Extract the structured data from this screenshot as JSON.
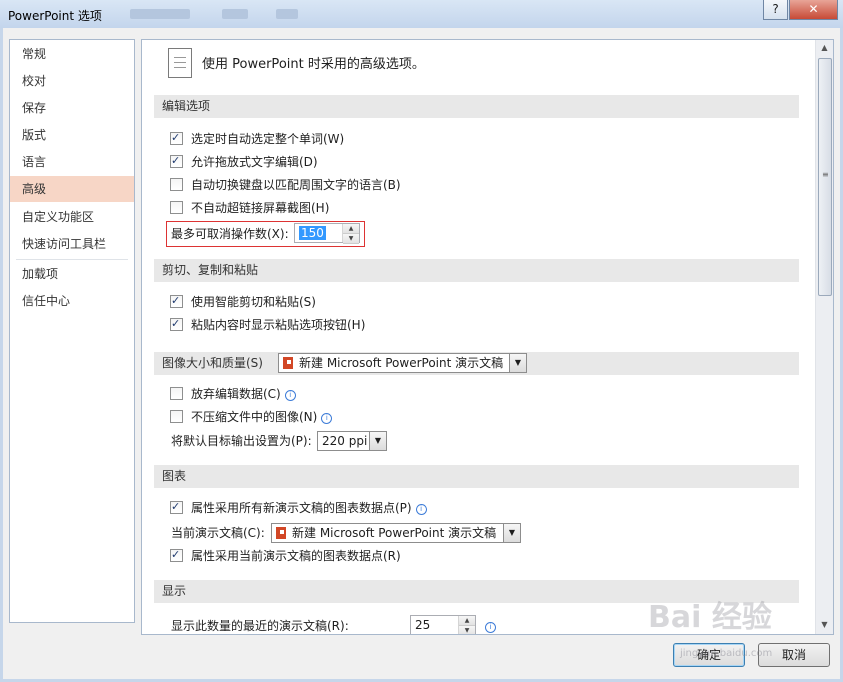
{
  "window": {
    "title": "PowerPoint 选项",
    "help_label": "?",
    "close_label": "✕"
  },
  "nav": {
    "items": [
      "常规",
      "校对",
      "保存",
      "版式",
      "语言",
      "高级",
      "自定义功能区",
      "快速访问工具栏",
      "加载项",
      "信任中心"
    ],
    "selected": "高级"
  },
  "header": {
    "text": "使用 PowerPoint 时采用的高级选项。"
  },
  "sections": {
    "edit": "编辑选项",
    "clipboard": "剪切、复制和粘贴",
    "image": "图像大小和质量(S)",
    "chart": "图表",
    "display": "显示"
  },
  "edit_options": {
    "opt1": "选定时自动选定整个单词(W)",
    "opt2": "允许拖放式文字编辑(D)",
    "opt3": "自动切换键盘以匹配周围文字的语言(B)",
    "opt4": "不自动超链接屏幕截图(H)",
    "undo_label": "最多可取消操作数(X):",
    "undo_value": "150"
  },
  "clipboard_options": {
    "opt1": "使用智能剪切和粘贴(S)",
    "opt2": "粘贴内容时显示粘贴选项按钮(H)"
  },
  "image_options": {
    "doc_select": "新建 Microsoft PowerPoint 演示文稿",
    "opt1": "放弃编辑数据(C)",
    "opt2": "不压缩文件中的图像(N)",
    "ppi_label": "将默认目标输出设置为(P):",
    "ppi_value": "220 ppi"
  },
  "chart_options": {
    "opt1": "属性采用所有新演示文稿的图表数据点(P)",
    "current_label": "当前演示文稿(C):",
    "current_value": "新建 Microsoft PowerPoint 演示文稿",
    "opt2": "属性采用当前演示文稿的图表数据点(R)"
  },
  "display_options": {
    "recent_label": "显示此数量的最近的演示文稿(R):",
    "recent_value": "25"
  },
  "buttons": {
    "ok": "确定",
    "cancel": "取消"
  },
  "watermark": {
    "text": "Bai 经验",
    "sub": "jingyan.baidu.com"
  }
}
